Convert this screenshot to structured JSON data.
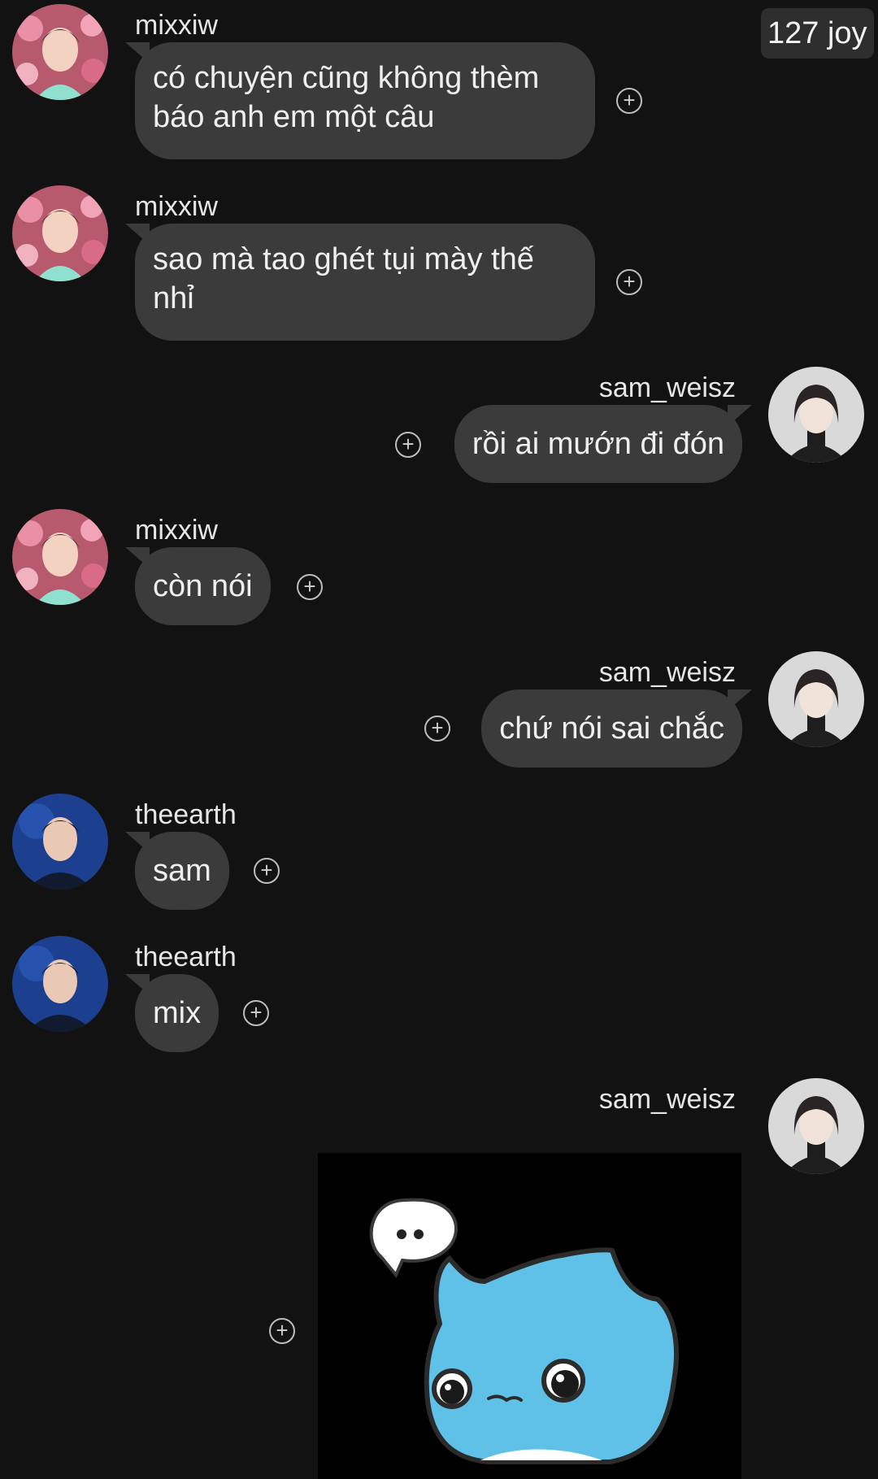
{
  "header": {
    "joy_count": "127 joy"
  },
  "messages": [
    {
      "sender": "mixxiw",
      "text": "có chuyện cũng không thèm\nbáo anh em một câu"
    },
    {
      "sender": "mixxiw",
      "text": "sao mà tao ghét tụi mày thế\nnhỉ"
    },
    {
      "sender": "sam_weisz",
      "text": "rồi ai mướn đi đón"
    },
    {
      "sender": "mixxiw",
      "text": "còn nói"
    },
    {
      "sender": "sam_weisz",
      "text": "chứ nói sai chắc"
    },
    {
      "sender": "theearth",
      "text": "sam"
    },
    {
      "sender": "theearth",
      "text": "mix"
    },
    {
      "sender": "sam_weisz",
      "sticker": "blue-cat-sticker"
    }
  ],
  "icons": {
    "react": "plus-circle-icon",
    "avatar_mixxiw": "avatar-mixxiw",
    "avatar_sam": "avatar-sam_weisz",
    "avatar_earth": "avatar-theearth"
  },
  "colors": {
    "background": "#121212",
    "bubble": "#3b3b3b",
    "text": "#efefef",
    "sticker_cat": "#5fc1e8"
  }
}
